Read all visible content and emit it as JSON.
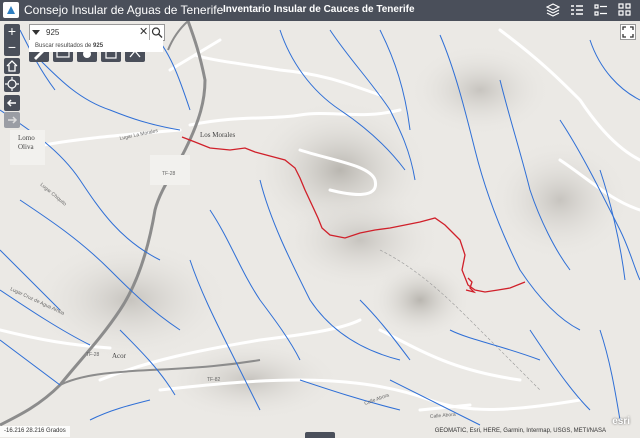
{
  "header": {
    "app_title": "Consejo Insular de Aguas de Tenerife",
    "sub_title": "Inventario Insular de Cauces de Tenerife"
  },
  "search": {
    "value": "925",
    "suggestion_prefix": "Buscar resultados de ",
    "suggestion_term": "925"
  },
  "map_labels": {
    "lomo_oliva_1": "Lomo",
    "lomo_oliva_2": "Oliva",
    "los_morales": "Los Morales",
    "road_tf28_a": "TF-28",
    "road_tf28_b": "TF-28",
    "road_tf82": "TF-82",
    "acor": "Acor",
    "lugar_la_morales": "Lugar La Morales",
    "lugar_chiquite": "Lugar Chiquito",
    "lugar_agua_arriba": "Lugar Cruz de Agua Arriba",
    "calle_abora": "Calle Abora",
    "calle_abora_2": "Calle Abora"
  },
  "status": {
    "coords": "-16.216 28.216 Grados",
    "attribution": "GEOMATIC, Esri, HERE, Garmin, Intermap, USGS, METI/NASA",
    "esri": "esri"
  },
  "colors": {
    "header_bg": "#4a4f5a",
    "river": "#2f6fd6",
    "road": "#888888",
    "route": "#d0202a"
  }
}
